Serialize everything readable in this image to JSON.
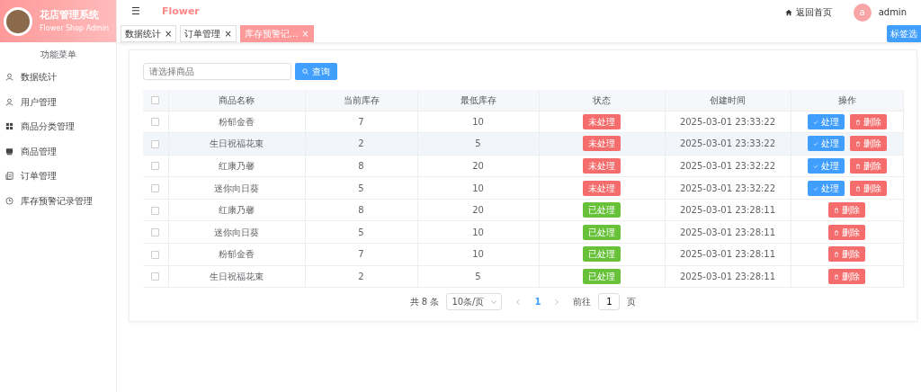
{
  "brand": {
    "title": "花店管理系统",
    "subtitle": "Flower Shop Admin"
  },
  "sidebar": {
    "heading": "功能菜单",
    "items": [
      {
        "label": "数据统计",
        "kind": "user",
        "selected": false
      },
      {
        "label": "用户管理",
        "kind": "user",
        "selected": false
      },
      {
        "label": "商品分类管理",
        "kind": "grid",
        "selected": false
      },
      {
        "label": "商品管理",
        "kind": "box",
        "selected": false
      },
      {
        "label": "订单管理",
        "kind": "doc",
        "selected": false
      },
      {
        "label": "库存预警记录管理",
        "kind": "clock",
        "selected": false
      }
    ]
  },
  "header": {
    "menu_icon": "☰",
    "title": "Flower",
    "home_link": "返回首页",
    "avatar_letter": "a",
    "user": "admin"
  },
  "tabs": [
    {
      "label": "数据统计",
      "close": "×",
      "selected": false
    },
    {
      "label": "订单管理",
      "close": "×",
      "selected": false
    },
    {
      "label": "库存预警记...",
      "close": "×",
      "selected": true
    }
  ],
  "tab_options_button": "标签选",
  "search": {
    "placeholder": "请选择商品",
    "button": "查询"
  },
  "table": {
    "select_all_checked": false,
    "columns": [
      "商品名称",
      "当前库存",
      "最低库存",
      "状态",
      "创建时间",
      "操作"
    ],
    "rows": [
      {
        "checked": false,
        "name": "粉郁金香",
        "stock": "7",
        "min": "10",
        "status": {
          "kind": "pending",
          "label": "未处理"
        },
        "time": "2025-03-01 23:33:22",
        "highlighted": false,
        "actions": [
          {
            "kind": "process",
            "label": "处理"
          },
          {
            "kind": "delete",
            "label": "删除"
          }
        ]
      },
      {
        "checked": false,
        "name": "生日祝福花束",
        "stock": "2",
        "min": "5",
        "status": {
          "kind": "pending",
          "label": "未处理"
        },
        "time": "2025-03-01 23:33:22",
        "highlighted": true,
        "actions": [
          {
            "kind": "process",
            "label": "处理"
          },
          {
            "kind": "delete",
            "label": "删除"
          }
        ]
      },
      {
        "checked": false,
        "name": "红康乃馨",
        "stock": "8",
        "min": "20",
        "status": {
          "kind": "pending",
          "label": "未处理"
        },
        "time": "2025-03-01 23:32:22",
        "highlighted": false,
        "actions": [
          {
            "kind": "process",
            "label": "处理"
          },
          {
            "kind": "delete",
            "label": "删除"
          }
        ]
      },
      {
        "checked": false,
        "name": "迷你向日葵",
        "stock": "5",
        "min": "10",
        "status": {
          "kind": "pending",
          "label": "未处理"
        },
        "time": "2025-03-01 23:32:22",
        "highlighted": false,
        "actions": [
          {
            "kind": "process",
            "label": "处理"
          },
          {
            "kind": "delete",
            "label": "删除"
          }
        ]
      },
      {
        "checked": false,
        "name": "红康乃馨",
        "stock": "8",
        "min": "20",
        "status": {
          "kind": "done",
          "label": "已处理"
        },
        "time": "2025-03-01 23:28:11",
        "highlighted": false,
        "actions": [
          {
            "kind": "delete",
            "label": "删除"
          }
        ]
      },
      {
        "checked": false,
        "name": "迷你向日葵",
        "stock": "5",
        "min": "10",
        "status": {
          "kind": "done",
          "label": "已处理"
        },
        "time": "2025-03-01 23:28:11",
        "highlighted": false,
        "actions": [
          {
            "kind": "delete",
            "label": "删除"
          }
        ]
      },
      {
        "checked": false,
        "name": "粉郁金香",
        "stock": "7",
        "min": "10",
        "status": {
          "kind": "done",
          "label": "已处理"
        },
        "time": "2025-03-01 23:28:11",
        "highlighted": false,
        "actions": [
          {
            "kind": "delete",
            "label": "删除"
          }
        ]
      },
      {
        "checked": false,
        "name": "生日祝福花束",
        "stock": "2",
        "min": "5",
        "status": {
          "kind": "done",
          "label": "已处理"
        },
        "time": "2025-03-01 23:28:11",
        "highlighted": false,
        "actions": [
          {
            "kind": "delete",
            "label": "删除"
          }
        ]
      }
    ]
  },
  "pagination": {
    "total": "共 8 条",
    "page_size": "10条/页",
    "pages": [
      {
        "label": "1",
        "selected": true
      }
    ],
    "goto_label": "前往",
    "goto_value": "1",
    "goto_suffix": "页"
  }
}
